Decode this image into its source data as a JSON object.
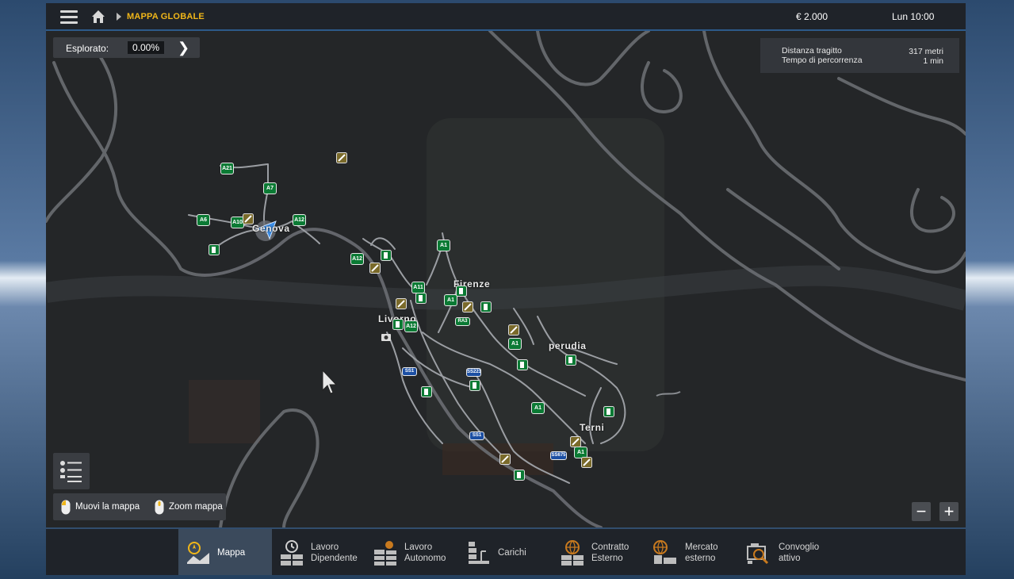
{
  "topbar": {
    "breadcrumb": "MAPPA GLOBALE",
    "money": "€ 2.000",
    "time": "Lun 10:00"
  },
  "explored": {
    "label": "Esplorato:",
    "value": "0.00%"
  },
  "route_info": {
    "distance_label": "Distanza tragitto",
    "distance_value": "317 metri",
    "time_label": "Tempo di percorrenza",
    "time_value": "1 min"
  },
  "map": {
    "cities": [
      "Genova",
      "Firenze",
      "Livorno",
      "perudia",
      "Terni"
    ],
    "highway_labels": [
      "A21",
      "A7",
      "A6",
      "A10",
      "A12",
      "A12",
      "A1",
      "A11",
      "A1",
      "A12",
      "A1",
      "A1",
      "A1",
      "SS1",
      "SS223",
      "SS1",
      "SS675",
      "RA3"
    ]
  },
  "controls": {
    "move_label": "Muovi la mappa",
    "zoom_label": "Zoom mappa",
    "zoom_out": "−",
    "zoom_in": "+"
  },
  "bottom_tabs": [
    {
      "line1": "Mappa",
      "line2": "",
      "icon": "map-icon",
      "active": true
    },
    {
      "line1": "Lavoro",
      "line2": "Dipendente",
      "icon": "clock-boxes-icon",
      "active": false
    },
    {
      "line1": "Lavoro",
      "line2": "Autonomo",
      "icon": "person-boxes-icon",
      "active": false
    },
    {
      "line1": "Carichi",
      "line2": "",
      "icon": "cargo-icon",
      "active": false
    },
    {
      "line1": "Contratto",
      "line2": "Esterno",
      "icon": "globe-boxes-icon",
      "active": false
    },
    {
      "line1": "Mercato",
      "line2": "esterno",
      "icon": "globe-truck-icon",
      "active": false
    },
    {
      "line1": "Convoglio",
      "line2": "attivo",
      "icon": "convoy-icon",
      "active": false
    }
  ],
  "colors": {
    "accent": "#f0b619",
    "highway_shield": "#0b7a34",
    "active_tab": "#3b4a5c",
    "panel": "#1f2329"
  }
}
